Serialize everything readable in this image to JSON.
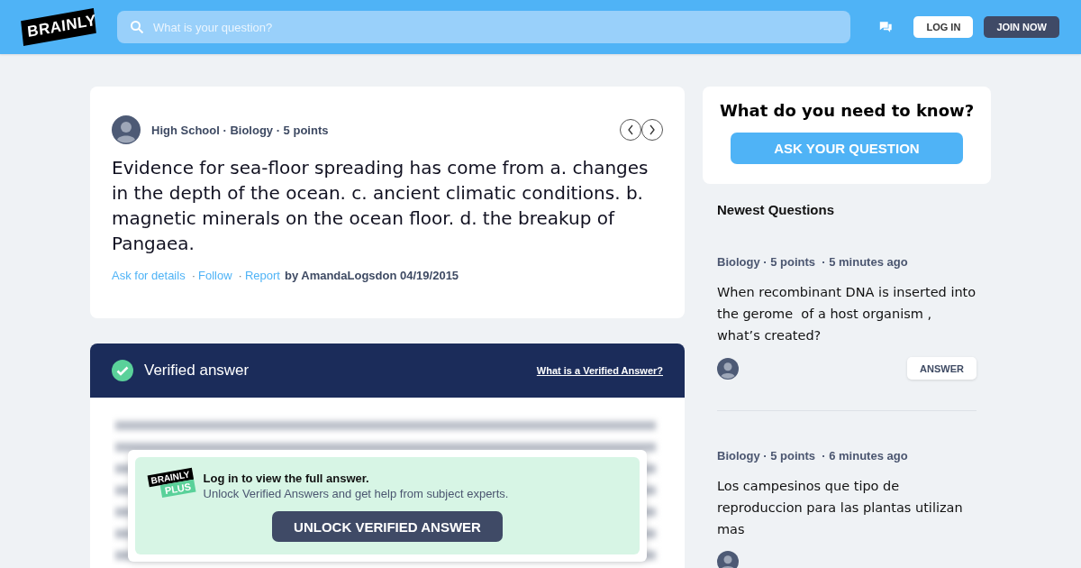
{
  "header": {
    "logo": "BRAINLY",
    "search": {
      "placeholder": "What is your question?"
    },
    "buttons": [
      {
        "label": "LOG IN",
        "kind": "light"
      },
      {
        "label": "JOIN NOW",
        "kind": "dark"
      }
    ]
  },
  "question": {
    "meta": "High School · Biology · 5 points",
    "text": "Evidence for sea-floor spreading has come from a. changes in the depth of the ocean. c. ancient climatic conditions. b. magnetic minerals on the ocean floor. d. the breakup of Pangaea.",
    "actions": [
      "Ask for details",
      "Follow",
      "Report"
    ],
    "separator": "·",
    "by": "by AmandaLogsdon 04/19/2015"
  },
  "answer": {
    "title": "Verified answer",
    "link": "What is a Verified Answer?",
    "paywall": {
      "logo_top": "BRAINLY",
      "logo_bottom": "PLUS",
      "title": "Log in to view the full answer.",
      "subtitle": "Unlock Verified Answers and get help from subject experts.",
      "button": "UNLOCK VERIFIED ANSWER"
    }
  },
  "ask": {
    "title": "What do you need to know?",
    "button": "ASK YOUR QUESTION"
  },
  "newest": {
    "title": "Newest Questions",
    "items": [
      {
        "meta": "Biology · 5 points  · 5 minutes ago",
        "text": "When recombinant DNA is inserted into the gerome  of a host organism , what’s created?",
        "button": "ANSWER"
      },
      {
        "meta": "Biology · 5 points  · 6 minutes ago",
        "text": "Los campesinos que tipo de reproduccion para las plantas utilizan mas"
      }
    ]
  }
}
